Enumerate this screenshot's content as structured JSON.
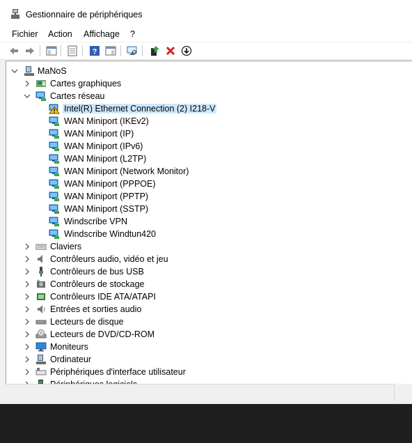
{
  "window": {
    "title": "Gestionnaire de périphériques"
  },
  "menu": [
    "Fichier",
    "Action",
    "Affichage",
    "?"
  ],
  "toolbar": {
    "buttons": [
      "back-icon",
      "forward-icon",
      "show-hide-console-tree-icon",
      "properties-icon",
      "help-icon",
      "action-pane-icon",
      "scan-hardware-icon",
      "update-driver-icon",
      "uninstall-icon",
      "disable-device-icon"
    ]
  },
  "tree": {
    "root": "MaNoS",
    "categories": [
      {
        "label": "Cartes graphiques",
        "icon": "display-adapter-icon",
        "expanded": false
      },
      {
        "label": "Cartes réseau",
        "icon": "network-adapter-icon",
        "expanded": true,
        "children": [
          {
            "label": "Intel(R) Ethernet Connection (2) I218-V",
            "icon": "network-warning-icon",
            "selected": true
          },
          {
            "label": "WAN Miniport (IKEv2)",
            "icon": "network-adapter-icon"
          },
          {
            "label": "WAN Miniport (IP)",
            "icon": "network-adapter-icon"
          },
          {
            "label": "WAN Miniport (IPv6)",
            "icon": "network-adapter-icon"
          },
          {
            "label": "WAN Miniport (L2TP)",
            "icon": "network-adapter-icon"
          },
          {
            "label": "WAN Miniport (Network Monitor)",
            "icon": "network-adapter-icon"
          },
          {
            "label": "WAN Miniport (PPPOE)",
            "icon": "network-adapter-icon"
          },
          {
            "label": "WAN Miniport (PPTP)",
            "icon": "network-adapter-icon"
          },
          {
            "label": "WAN Miniport (SSTP)",
            "icon": "network-adapter-icon"
          },
          {
            "label": "Windscribe VPN",
            "icon": "network-adapter-icon"
          },
          {
            "label": "Windscribe Windtun420",
            "icon": "network-adapter-icon"
          }
        ]
      },
      {
        "label": "Claviers",
        "icon": "keyboard-icon",
        "expanded": false
      },
      {
        "label": "Contrôleurs audio, vidéo et jeu",
        "icon": "speaker-icon",
        "expanded": false
      },
      {
        "label": "Contrôleurs de bus USB",
        "icon": "usb-icon",
        "expanded": false
      },
      {
        "label": "Contrôleurs de stockage",
        "icon": "storage-controller-icon",
        "expanded": false
      },
      {
        "label": "Contrôleurs IDE ATA/ATAPI",
        "icon": "ide-controller-icon",
        "expanded": false
      },
      {
        "label": "Entrées et sorties audio",
        "icon": "audio-io-icon",
        "expanded": false
      },
      {
        "label": "Lecteurs de disque",
        "icon": "disk-drive-icon",
        "expanded": false
      },
      {
        "label": "Lecteurs de DVD/CD-ROM",
        "icon": "dvd-drive-icon",
        "expanded": false
      },
      {
        "label": "Moniteurs",
        "icon": "monitor-icon",
        "expanded": false
      },
      {
        "label": "Ordinateur",
        "icon": "computer-icon",
        "expanded": false
      },
      {
        "label": "Périphériques d'interface utilisateur",
        "icon": "hid-icon",
        "expanded": false
      },
      {
        "label": "Périphériques logiciels",
        "icon": "software-device-icon",
        "expanded": false
      }
    ]
  }
}
